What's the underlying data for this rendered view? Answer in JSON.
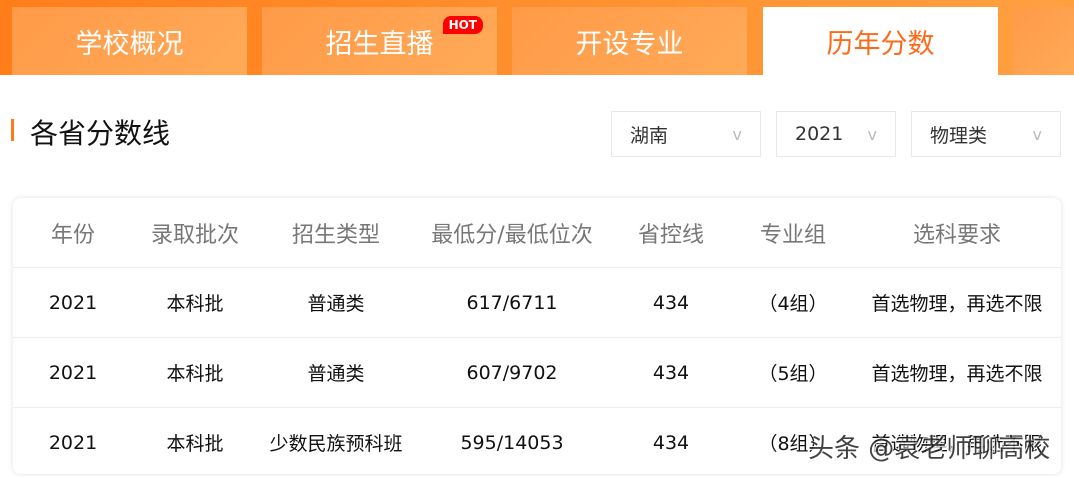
{
  "tabs": [
    {
      "label": "学校概况"
    },
    {
      "label": "招生直播",
      "badge": "HOT"
    },
    {
      "label": "开设专业"
    },
    {
      "label": "历年分数",
      "active": true
    }
  ],
  "section_title": "各省分数线",
  "filters": {
    "province": "湖南",
    "year": "2021",
    "subject": "物理类"
  },
  "table": {
    "headers": [
      "年份",
      "录取批次",
      "招生类型",
      "最低分/最低位次",
      "省控线",
      "专业组",
      "选科要求"
    ],
    "rows": [
      [
        "2021",
        "本科批",
        "普通类",
        "617/6711",
        "434",
        "（4组）",
        "首选物理，再选不限"
      ],
      [
        "2021",
        "本科批",
        "普通类",
        "607/9702",
        "434",
        "（5组）",
        "首选物理，再选不限"
      ],
      [
        "2021",
        "本科批",
        "少数民族预科班",
        "595/14053",
        "434",
        "（8组）",
        "首选物理，再选不限"
      ]
    ]
  },
  "watermark": "头条 @袁老师聊高校",
  "colors": {
    "accent": "#ff7a1a",
    "hot": "#ff0000"
  }
}
